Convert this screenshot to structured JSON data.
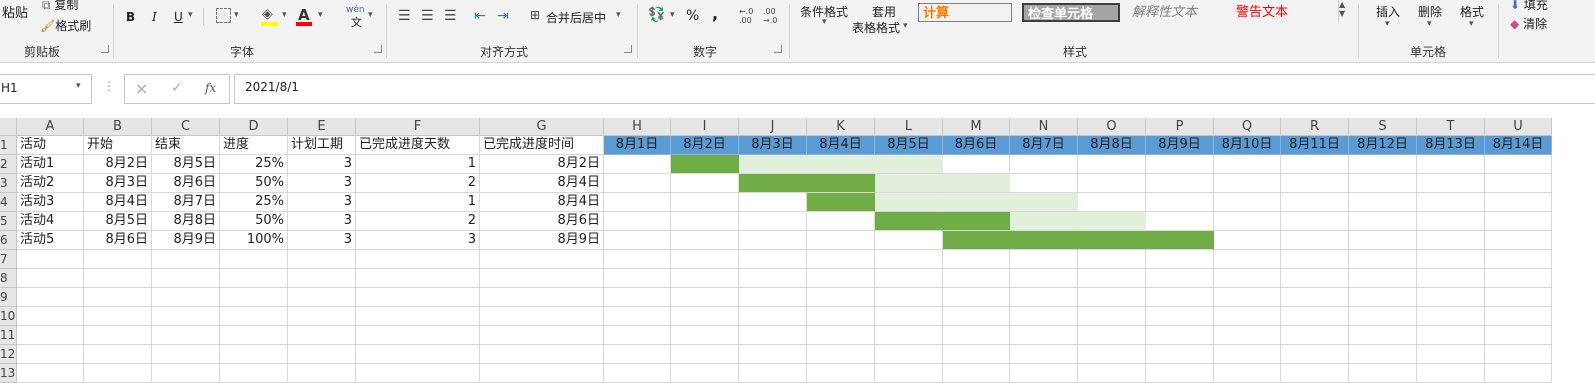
{
  "ribbon": {
    "paste_label": "粘贴",
    "copy_label": "复制",
    "format_painter_label": "格式刷",
    "clipboard_group": "剪贴板",
    "bold": "B",
    "italic": "I",
    "underline": "U",
    "font_group": "字体",
    "phonetic_label": "wén",
    "merge_center_label": "合并后居中",
    "alignment_group": "对齐方式",
    "percent_label": "%",
    "comma_label": ",",
    "increase_decimal": "←.0 .00",
    "decrease_decimal": ".00 →.0",
    "number_group": "数字",
    "conditional_format_label": "条件格式",
    "table_format_label1": "套用",
    "table_format_label2": "表格格式",
    "style_calc": "计算",
    "style_check": "检查单元格",
    "style_explain": "解释性文本",
    "style_warning": "警告文本",
    "styles_group": "样式",
    "insert_label": "插入",
    "delete_label": "删除",
    "format_label": "格式",
    "cells_group": "单元格",
    "fill_label": "填充",
    "clear_label": "清除",
    "colors": {
      "calc_text": "#fa7d00",
      "calc_bg": "#f2f2f2",
      "check_bg": "#a5a5a5",
      "warning": "#ff0000",
      "font_color_bar": "#ff0000",
      "fill_color_bar": "#ffff00"
    }
  },
  "formula_bar": {
    "name_box": "H1",
    "cancel_icon": "×",
    "enter_icon": "✓",
    "fx_label": "fx",
    "formula_value": "2021/8/1"
  },
  "columns": [
    "A",
    "B",
    "C",
    "D",
    "E",
    "F",
    "G",
    "H",
    "I",
    "J",
    "K",
    "L",
    "M",
    "N",
    "O",
    "P",
    "Q",
    "R",
    "S",
    "T",
    "U"
  ],
  "rows": [
    "1",
    "2",
    "3",
    "4",
    "5",
    "6",
    "7",
    "8",
    "9",
    "10",
    "11",
    "12",
    "13"
  ],
  "table": {
    "headers": [
      "活动",
      "开始",
      "结束",
      "进度",
      "计划工期",
      "已完成进度天数",
      "已完成进度时间"
    ],
    "data": [
      [
        "活动1",
        "8月2日",
        "8月5日",
        "25%",
        "3",
        "1",
        "8月2日"
      ],
      [
        "活动2",
        "8月3日",
        "8月6日",
        "50%",
        "3",
        "2",
        "8月4日"
      ],
      [
        "活动3",
        "8月4日",
        "8月7日",
        "25%",
        "3",
        "1",
        "8月4日"
      ],
      [
        "活动4",
        "8月5日",
        "8月8日",
        "50%",
        "3",
        "2",
        "8月6日"
      ],
      [
        "活动5",
        "8月6日",
        "8月9日",
        "100%",
        "3",
        "3",
        "8月9日"
      ]
    ]
  },
  "gantt": {
    "dates": [
      "8月1日",
      "8月2日",
      "8月3日",
      "8月4日",
      "8月5日",
      "8月6日",
      "8月7日",
      "8月8日",
      "8月9日",
      "8月10日",
      "8月11日",
      "8月12日",
      "8月13日",
      "8月14日"
    ],
    "header_color": "#5b9bd5",
    "done_color": "#70ad47",
    "plan_color": "#e2efda"
  }
}
